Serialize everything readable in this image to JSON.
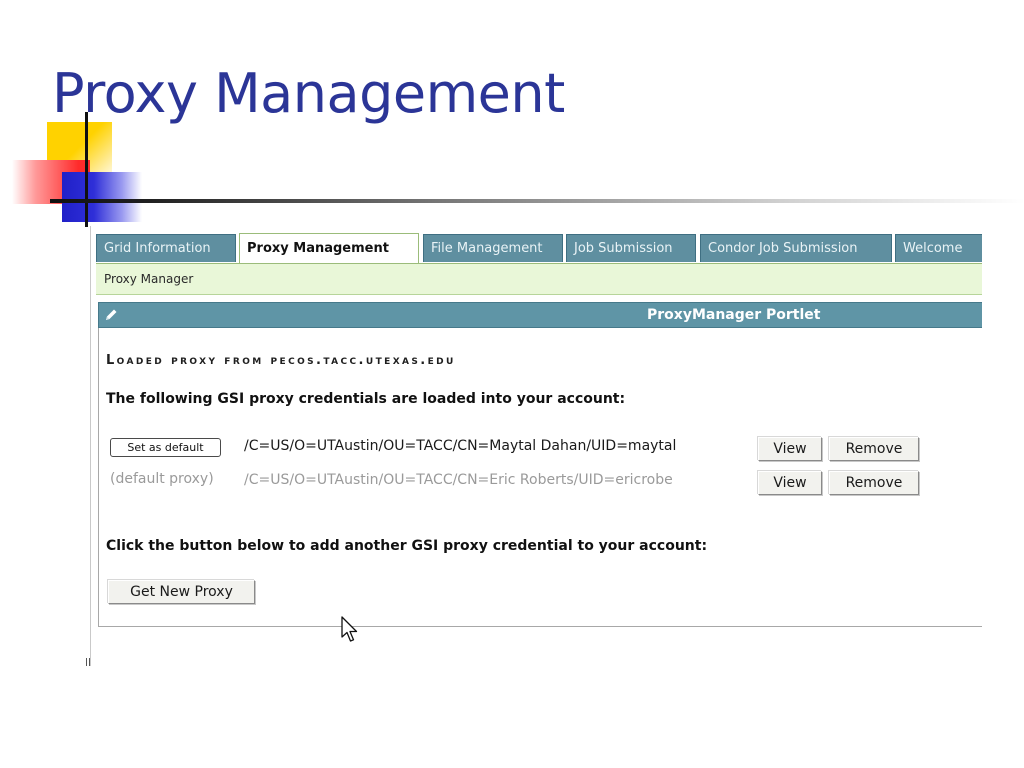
{
  "slide": {
    "title": "Proxy Management"
  },
  "tabs": [
    {
      "label": "Grid Information",
      "active": false
    },
    {
      "label": "Proxy Management",
      "active": true
    },
    {
      "label": "File Management",
      "active": false
    },
    {
      "label": "Job Submission",
      "active": false
    },
    {
      "label": "Condor Job Submission",
      "active": false
    },
    {
      "label": "Welcome",
      "active": false
    }
  ],
  "subnav": {
    "label": "Proxy Manager"
  },
  "portlet": {
    "title": "ProxyManager Portlet",
    "edit_icon": "pencil-icon",
    "loaded_heading": "Loaded proxy from pecos.tacc.utexas.edu",
    "intro_text": "The following GSI proxy credentials are loaded into your account:",
    "credentials": [
      {
        "action_label": "Set as default",
        "dn": "/C=US/O=UTAustin/OU=TACC/CN=Maytal Dahan/UID=maytal",
        "view_label": "View",
        "remove_label": "Remove"
      },
      {
        "status_label": "(default proxy)",
        "dn": "/C=US/O=UTAustin/OU=TACC/CN=Eric Roberts/UID=ericrobe",
        "view_label": "View",
        "remove_label": "Remove"
      }
    ],
    "add_text": "Click the button below to add another GSI proxy credential to your account:",
    "get_proxy_label": "Get New Proxy"
  },
  "colors": {
    "title": "#2b3597",
    "tab_inactive": "#5f8fa0",
    "portlet_header": "#5f95a6",
    "subnav_bg": "#e9f7d8"
  }
}
